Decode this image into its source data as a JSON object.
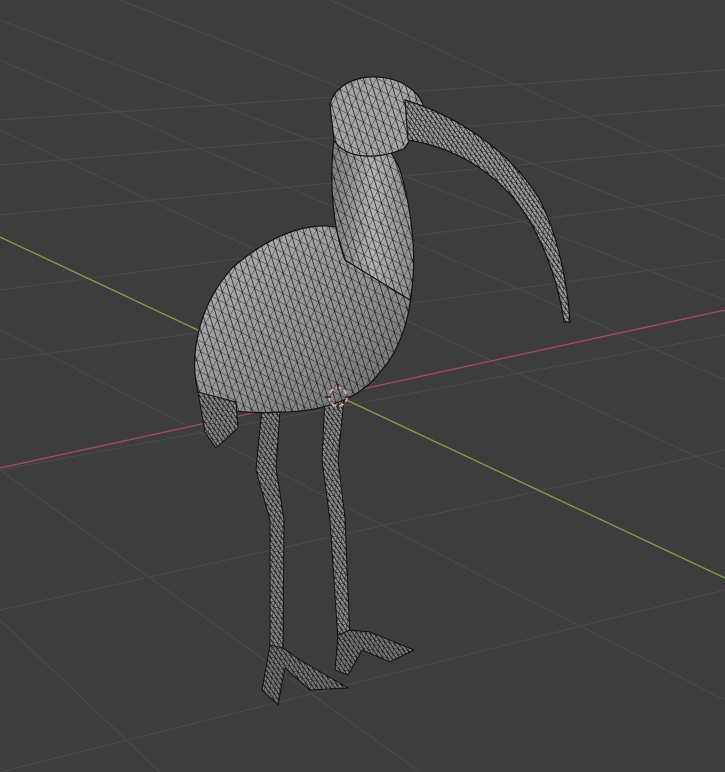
{
  "viewport": {
    "background_color": "#3d3d3d",
    "grid_color": "#4a4a4a",
    "x_axis_color": "#a04a55",
    "y_axis_color": "#7f9a4a",
    "mesh_fill_color": "#9c9c9c",
    "wire_color": "#111111",
    "cursor_color": "#d98a8a",
    "view_mode": "wireframe-overlay",
    "object": "bird-mesh"
  }
}
